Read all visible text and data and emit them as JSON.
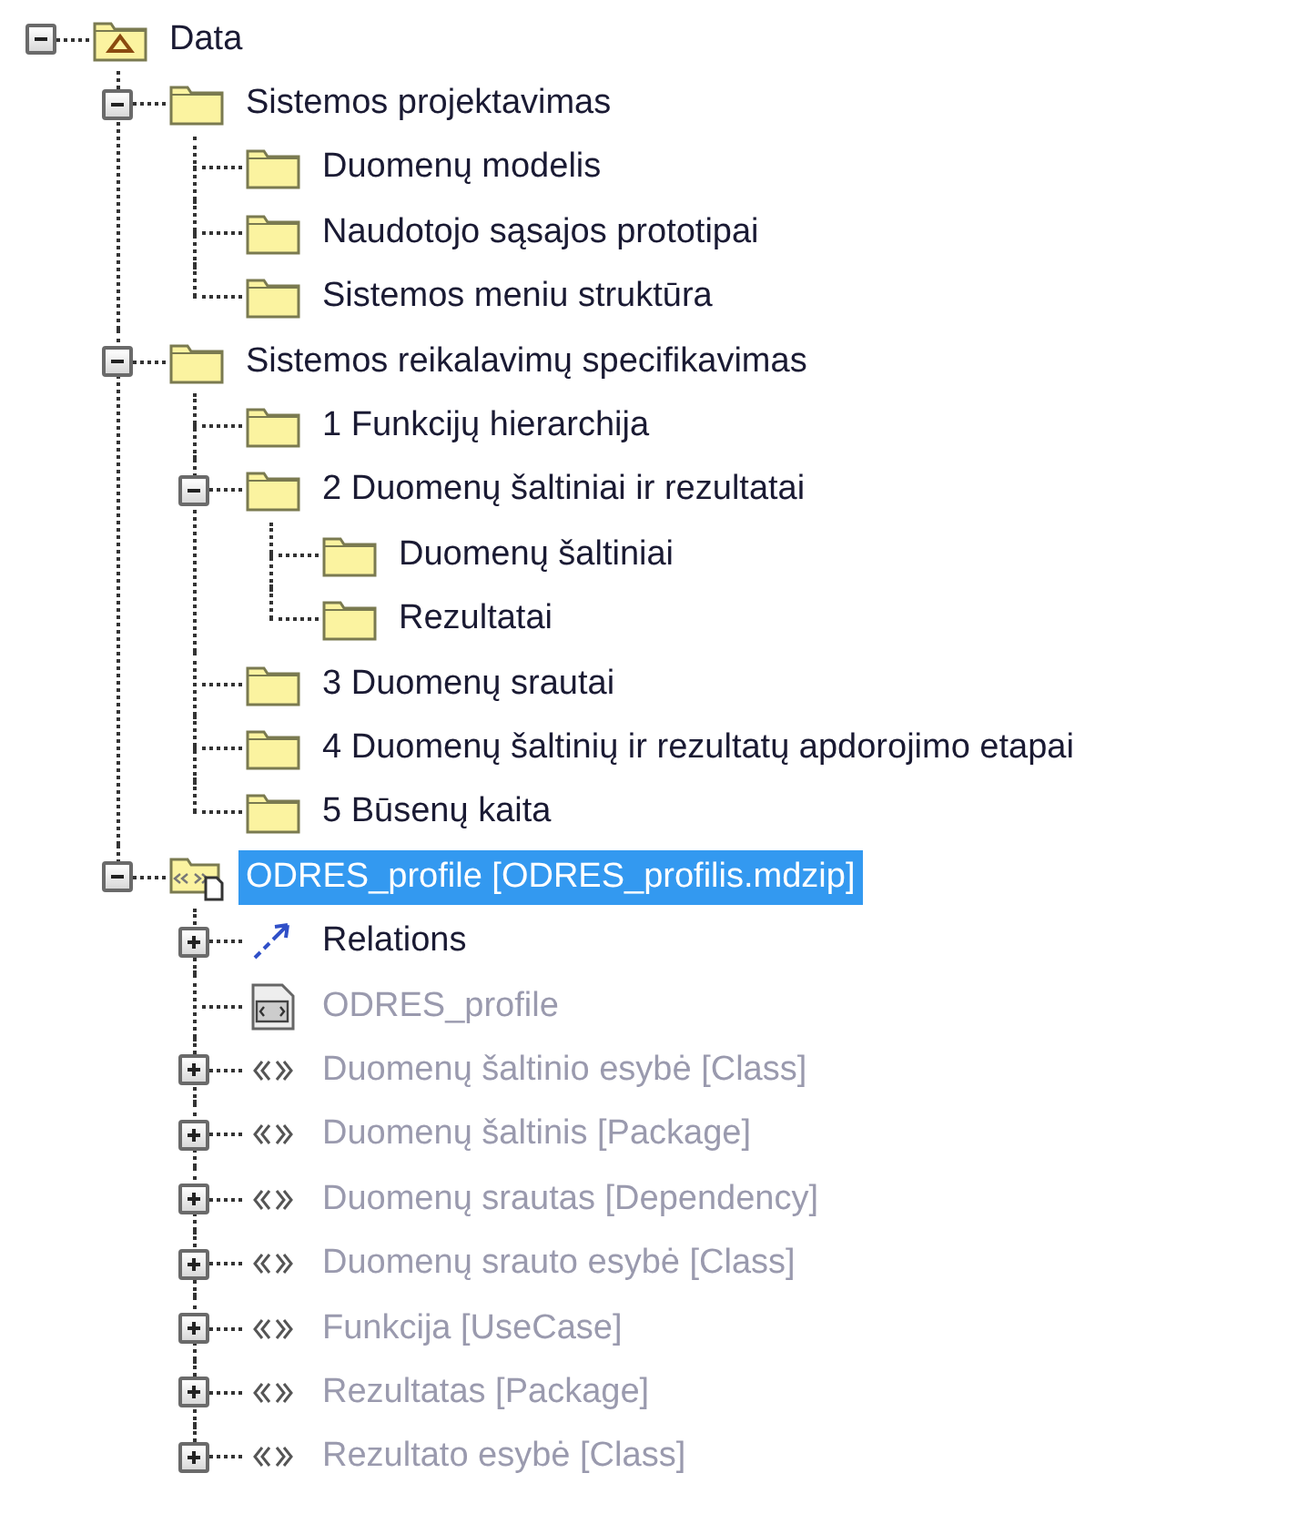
{
  "tree": [
    {
      "kind": "model",
      "label": "Data",
      "expanded": true,
      "selected": false,
      "disabled": false,
      "children": [
        {
          "kind": "folder",
          "label": "Sistemos projektavimas",
          "expanded": true,
          "selected": false,
          "disabled": false,
          "children": [
            {
              "kind": "folder",
              "label": "Duomenų modelis",
              "selected": false,
              "disabled": false
            },
            {
              "kind": "folder",
              "label": "Naudotojo sąsajos prototipai",
              "selected": false,
              "disabled": false
            },
            {
              "kind": "folder",
              "label": "Sistemos meniu struktūra",
              "selected": false,
              "disabled": false
            }
          ]
        },
        {
          "kind": "folder",
          "label": "Sistemos reikalavimų specifikavimas",
          "expanded": true,
          "selected": false,
          "disabled": false,
          "children": [
            {
              "kind": "folder",
              "label": "1 Funkcijų hierarchija",
              "selected": false,
              "disabled": false
            },
            {
              "kind": "folder",
              "label": "2 Duomenų šaltiniai ir rezultatai",
              "expanded": true,
              "selected": false,
              "disabled": false,
              "children": [
                {
                  "kind": "folder",
                  "label": "Duomenų šaltiniai",
                  "selected": false,
                  "disabled": false
                },
                {
                  "kind": "folder",
                  "label": "Rezultatai",
                  "selected": false,
                  "disabled": false
                }
              ]
            },
            {
              "kind": "folder",
              "label": "3 Duomenų srautai",
              "selected": false,
              "disabled": false
            },
            {
              "kind": "folder",
              "label": "4 Duomenų šaltinių ir rezultatų apdorojimo etapai",
              "selected": false,
              "disabled": false
            },
            {
              "kind": "folder",
              "label": "5 Būsenų kaita",
              "selected": false,
              "disabled": false
            }
          ]
        },
        {
          "kind": "profile",
          "label": "ODRES_profile [ODRES_profilis.mdzip]",
          "expanded": true,
          "selected": true,
          "disabled": false,
          "children": [
            {
              "kind": "relations",
              "label": "Relations",
              "expanded": false,
              "selected": false,
              "disabled": false
            },
            {
              "kind": "diagram",
              "label": "ODRES_profile",
              "selected": false,
              "disabled": true
            },
            {
              "kind": "stereotype",
              "label": "Duomenų šaltinio esybė [Class]",
              "expanded": false,
              "selected": false,
              "disabled": true
            },
            {
              "kind": "stereotype",
              "label": "Duomenų šaltinis [Package]",
              "expanded": false,
              "selected": false,
              "disabled": true
            },
            {
              "kind": "stereotype",
              "label": "Duomenų srautas [Dependency]",
              "expanded": false,
              "selected": false,
              "disabled": true
            },
            {
              "kind": "stereotype",
              "label": "Duomenų srauto esybė [Class]",
              "expanded": false,
              "selected": false,
              "disabled": true
            },
            {
              "kind": "stereotype",
              "label": "Funkcija [UseCase]",
              "expanded": false,
              "selected": false,
              "disabled": true
            },
            {
              "kind": "stereotype",
              "label": "Rezultatas [Package]",
              "expanded": false,
              "selected": false,
              "disabled": true
            },
            {
              "kind": "stereotype",
              "label": "Rezultato esybė [Class]",
              "expanded": false,
              "selected": false,
              "disabled": true
            }
          ]
        }
      ]
    }
  ]
}
